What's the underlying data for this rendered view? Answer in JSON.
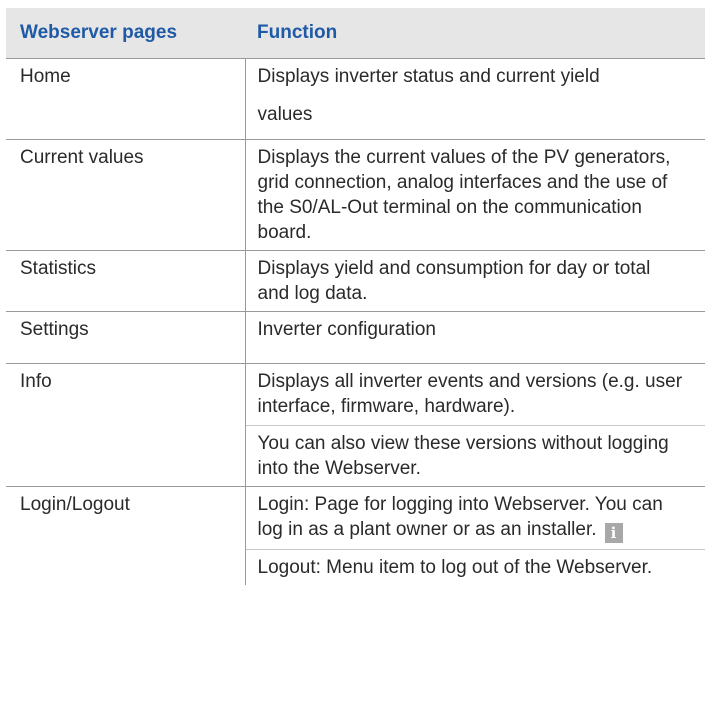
{
  "table": {
    "headers": {
      "page": "Webserver pages",
      "function": "Function"
    },
    "rows": [
      {
        "page": "Home",
        "paragraphs": [
          "Displays inverter status and current yield values"
        ]
      },
      {
        "page": "Current values",
        "paragraphs": [
          "Displays the current values of the PV generators, grid connection, analog interfaces and the use of the S0/AL-Out terminal on the communication board."
        ]
      },
      {
        "page": "Statistics",
        "paragraphs": [
          "Displays yield and consumption for day or total and log data."
        ]
      },
      {
        "page": "Settings",
        "paragraphs": [
          "Inverter configuration"
        ]
      },
      {
        "page": "Info",
        "paragraphs": [
          "Displays all inverter events and versions (e.g. user interface, firmware, hardware).",
          "You can also view these versions without logging into the Webserver."
        ]
      },
      {
        "page": "Login/Logout",
        "paragraphs": [
          "Login: Page for logging into Webserver. You can log in as a plant owner or as an installer.",
          "Logout: Menu item to log out of the Webserver."
        ]
      }
    ],
    "info_icon": {
      "name": "info-icon",
      "glyph": "i",
      "color": "#a8a8a8"
    },
    "colors": {
      "header_background": "#e6e6e6",
      "header_text": "#1f5aa6",
      "border": "#9a9a9a"
    }
  }
}
